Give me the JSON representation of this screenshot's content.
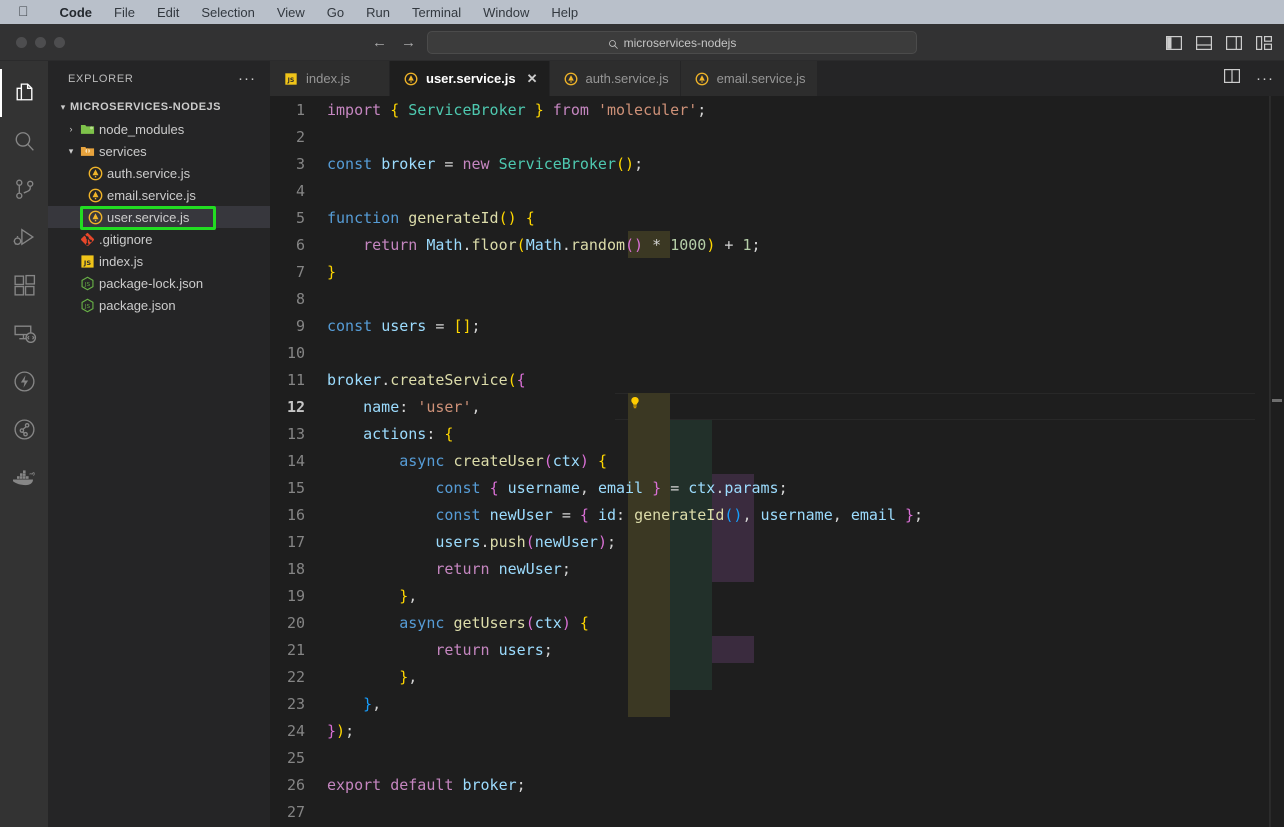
{
  "mac_menubar": {
    "apple_icon": "apple-logo",
    "items": [
      {
        "label": "Code",
        "bold": true
      },
      {
        "label": "File",
        "bold": false
      },
      {
        "label": "Edit",
        "bold": false
      },
      {
        "label": "Selection",
        "bold": false
      },
      {
        "label": "View",
        "bold": false
      },
      {
        "label": "Go",
        "bold": false
      },
      {
        "label": "Run",
        "bold": false
      },
      {
        "label": "Terminal",
        "bold": false
      },
      {
        "label": "Window",
        "bold": false
      },
      {
        "label": "Help",
        "bold": false
      }
    ]
  },
  "titlebar": {
    "back_arrow": "←",
    "forward_arrow": "→",
    "quick_search_text": "microservices-nodejs",
    "quick_search_icon": "search-icon",
    "layout_actions": [
      {
        "name": "toggle-primary-sidebar-icon"
      },
      {
        "name": "toggle-panel-icon"
      },
      {
        "name": "toggle-secondary-sidebar-icon"
      },
      {
        "name": "customize-layout-icon"
      }
    ]
  },
  "activitybar": {
    "items": [
      {
        "name": "explorer-icon",
        "active": true
      },
      {
        "name": "search-icon",
        "active": false
      },
      {
        "name": "source-control-icon",
        "active": false
      },
      {
        "name": "run-and-debug-icon",
        "active": false
      },
      {
        "name": "extensions-icon",
        "active": false
      },
      {
        "name": "remote-explorer-icon",
        "active": false
      },
      {
        "name": "thunder-client-icon",
        "active": false
      },
      {
        "name": "gitlens-icon",
        "active": false
      },
      {
        "name": "docker-icon",
        "active": false
      }
    ]
  },
  "sidebar": {
    "header_title": "EXPLORER",
    "more_actions": "···",
    "tree": [
      {
        "label": "MICROSERVICES-NODEJS",
        "kind": "root",
        "indent": 0,
        "twisty": "▾",
        "icon": "",
        "selected": false
      },
      {
        "label": "node_modules",
        "kind": "folder",
        "indent": 1,
        "twisty": "›",
        "icon": "folder-icon",
        "selected": false
      },
      {
        "label": "services",
        "kind": "folder",
        "indent": 1,
        "twisty": "▾",
        "icon": "folder-open-icon",
        "selected": false
      },
      {
        "label": "auth.service.js",
        "kind": "file",
        "indent": 2,
        "twisty": "",
        "icon": "moleculer-js-icon",
        "selected": false
      },
      {
        "label": "email.service.js",
        "kind": "file",
        "indent": 2,
        "twisty": "",
        "icon": "moleculer-js-icon",
        "selected": false
      },
      {
        "label": "user.service.js",
        "kind": "file",
        "indent": 2,
        "twisty": "",
        "icon": "moleculer-js-icon",
        "selected": true
      },
      {
        "label": ".gitignore",
        "kind": "file",
        "indent": 1,
        "twisty": "",
        "icon": "git-icon",
        "selected": false
      },
      {
        "label": "index.js",
        "kind": "file",
        "indent": 1,
        "twisty": "",
        "icon": "js-icon",
        "selected": false
      },
      {
        "label": "package-lock.json",
        "kind": "file",
        "indent": 1,
        "twisty": "",
        "icon": "npm-icon",
        "selected": false
      },
      {
        "label": "package.json",
        "kind": "file",
        "indent": 1,
        "twisty": "",
        "icon": "npm-icon",
        "selected": false
      }
    ],
    "annotation": {
      "color": "#22dd22",
      "target": "user.service.js"
    }
  },
  "tabs": [
    {
      "label": "index.js",
      "icon": "js-icon",
      "active": false,
      "closable": false
    },
    {
      "label": "user.service.js",
      "icon": "moleculer-js-icon",
      "active": true,
      "closable": true,
      "close_glyph": "✕"
    },
    {
      "label": "auth.service.js",
      "icon": "moleculer-js-icon",
      "active": false,
      "closable": false
    },
    {
      "label": "email.service.js",
      "icon": "moleculer-js-icon",
      "active": false,
      "closable": false
    }
  ],
  "tab_actions": [
    {
      "name": "split-editor-right-icon"
    },
    {
      "name": "more-editor-actions-icon",
      "glyph": "···"
    }
  ],
  "editor": {
    "filename": "user.service.js",
    "language": "javascript",
    "current_line": 12,
    "code_action_lightbulb_line": 12,
    "total_visible_lines": 27,
    "lines": [
      {
        "n": 1,
        "text": "import { ServiceBroker } from 'moleculer';"
      },
      {
        "n": 2,
        "text": ""
      },
      {
        "n": 3,
        "text": "const broker = new ServiceBroker();"
      },
      {
        "n": 4,
        "text": ""
      },
      {
        "n": 5,
        "text": "function generateId() {"
      },
      {
        "n": 6,
        "text": "    return Math.floor(Math.random() * 1000) + 1;"
      },
      {
        "n": 7,
        "text": "}"
      },
      {
        "n": 8,
        "text": ""
      },
      {
        "n": 9,
        "text": "const users = [];"
      },
      {
        "n": 10,
        "text": ""
      },
      {
        "n": 11,
        "text": "broker.createService({"
      },
      {
        "n": 12,
        "text": "    name: 'user',"
      },
      {
        "n": 13,
        "text": "    actions: {"
      },
      {
        "n": 14,
        "text": "        async createUser(ctx) {"
      },
      {
        "n": 15,
        "text": "            const { username, email } = ctx.params;"
      },
      {
        "n": 16,
        "text": "            const newUser = { id: generateId(), username, email };"
      },
      {
        "n": 17,
        "text": "            users.push(newUser);"
      },
      {
        "n": 18,
        "text": "            return newUser;"
      },
      {
        "n": 19,
        "text": "        },"
      },
      {
        "n": 20,
        "text": "        async getUsers(ctx) {"
      },
      {
        "n": 21,
        "text": "            return users;"
      },
      {
        "n": 22,
        "text": "        },"
      },
      {
        "n": 23,
        "text": "    },"
      },
      {
        "n": 24,
        "text": "});"
      },
      {
        "n": 25,
        "text": ""
      },
      {
        "n": 26,
        "text": "export default broker;"
      },
      {
        "n": 27,
        "text": ""
      }
    ]
  },
  "colors": {
    "editor_background": "#1e1e1e",
    "sidebar_background": "#252526",
    "activitybar_background": "#333333",
    "titlebar_background": "#323233",
    "menubar_background": "#b9c0ca",
    "annotation_green": "#22dd22",
    "indent_guide_olive": "#3b3823",
    "indent_guide_green": "#22302a",
    "indent_guide_purple": "#3a2b3e",
    "selected_row": "#37373d"
  }
}
